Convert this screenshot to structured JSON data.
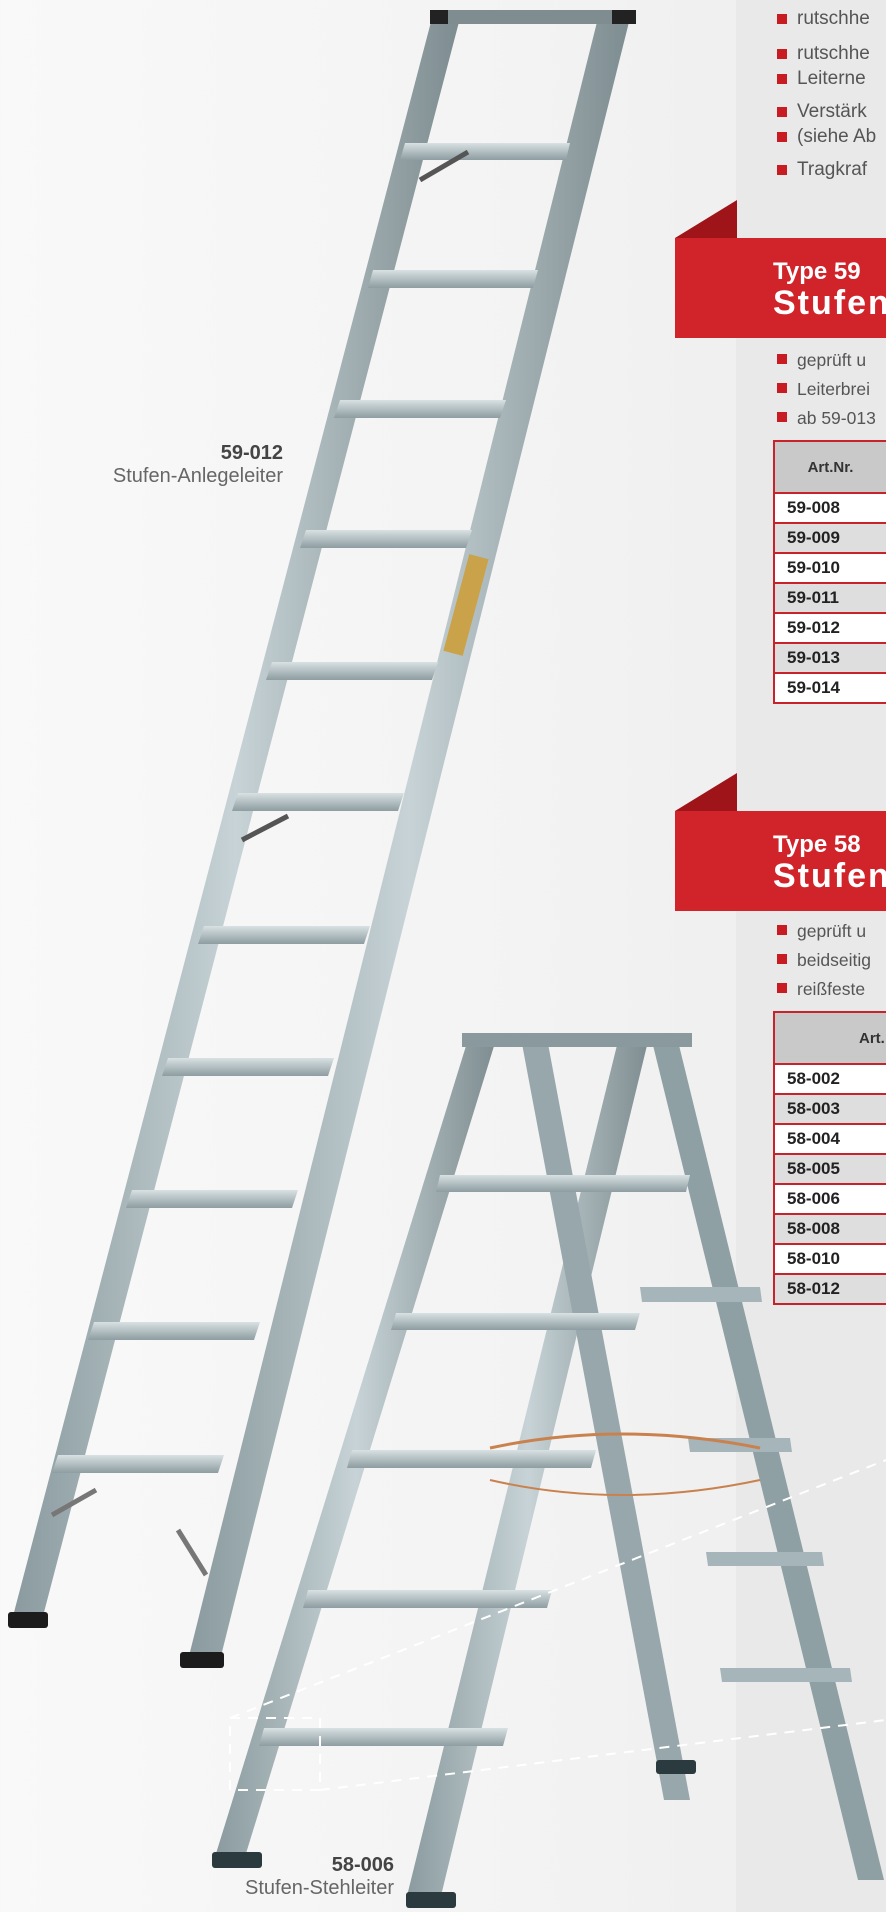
{
  "top_bullets": [
    "rutschhe",
    "rutschhe",
    "Leiterne",
    "Verstärk",
    "(siehe Ab",
    "Tragkraf"
  ],
  "type59": {
    "type": "Type 59",
    "name": "Stufen",
    "bullets": [
      "geprüft u",
      "Leiterbrei",
      "ab 59-013"
    ],
    "col_header": "Art.Nr.",
    "rows": [
      "59-008",
      "59-009",
      "59-010",
      "59-011",
      "59-012",
      "59-013",
      "59-014"
    ]
  },
  "type58": {
    "type": "Type 58",
    "name": "Stufen",
    "bullets": [
      "geprüft u",
      "beidseitig",
      "reißfeste"
    ],
    "col_header": "Art.",
    "rows": [
      "58-002",
      "58-003",
      "58-004",
      "58-005",
      "58-006",
      "58-008",
      "58-010",
      "58-012"
    ]
  },
  "product_labels": {
    "leaning": {
      "code": "59-012",
      "desc": "Stufen-Anlegeleiter"
    },
    "standing": {
      "code": "58-006",
      "desc": "Stufen-Stehleiter"
    }
  },
  "colors": {
    "accent": "#d0232a",
    "ladder": "#a8b8bd"
  }
}
